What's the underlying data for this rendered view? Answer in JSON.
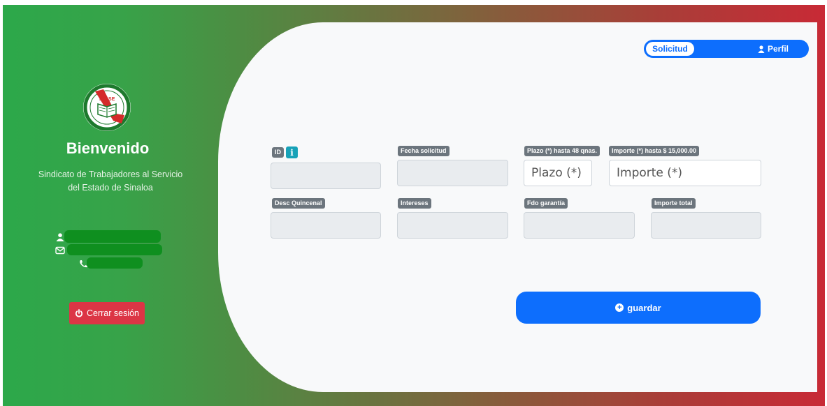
{
  "sidebar": {
    "welcome": "Bienvenido",
    "organization": "Sindicato de Trabajadores al Servicio del Estado de Sinaloa",
    "logo_text": "STASE",
    "logout_label": "Cerrar sesión"
  },
  "toggle": {
    "solicitud_label": "Solicitud",
    "perfil_label": "Perfil"
  },
  "form": {
    "id_label": "ID",
    "info_glyph": "i",
    "fecha_label": "Fecha solicitud",
    "plazo_label": "Plazo (*) hasta 48 qnas.",
    "plazo_placeholder": "Plazo (*)",
    "importe_label": "Importe (*) hasta $ 15,000.00",
    "importe_placeholder": "Importe (*)",
    "desc_label": "Desc Quincenal",
    "intereses_label": "Intereses",
    "fdo_label": "Fdo garantía",
    "total_label": "Importe total",
    "save_label": "guardar"
  },
  "colors": {
    "gradient_left": "#2ca84a",
    "gradient_right": "#c82a36",
    "primary": "#0d6efd",
    "danger": "#dc3545",
    "badge": "#6c757d",
    "info": "#17a2b8"
  }
}
